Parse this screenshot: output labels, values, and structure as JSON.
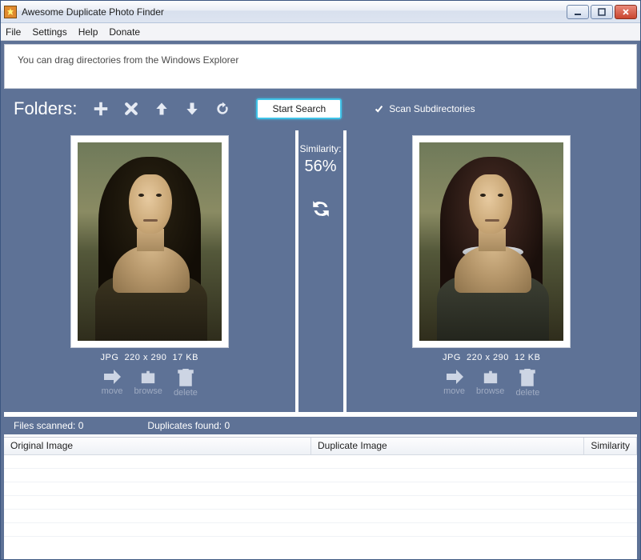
{
  "window": {
    "title": "Awesome Duplicate Photo Finder"
  },
  "menu": {
    "file": "File",
    "settings": "Settings",
    "help": "Help",
    "donate": "Donate"
  },
  "drop_hint": "You can drag directories from the Windows Explorer",
  "toolbar": {
    "folders_label": "Folders:",
    "start_search": "Start Search",
    "scan_sub": "Scan Subdirectories",
    "scan_sub_checked": true
  },
  "similarity": {
    "label": "Similarity:",
    "value": "56%"
  },
  "left": {
    "format": "JPG",
    "dimensions": "220 x 290",
    "size": "17 KB",
    "move": "move",
    "browse": "browse",
    "delete": "delete"
  },
  "right": {
    "format": "JPG",
    "dimensions": "220 x 290",
    "size": "12 KB",
    "move": "move",
    "browse": "browse",
    "delete": "delete"
  },
  "status": {
    "files_scanned_label": "Files scanned:",
    "files_scanned_value": "0",
    "dupes_label": "Duplicates found:",
    "dupes_value": "0"
  },
  "table": {
    "col_original": "Original Image",
    "col_duplicate": "Duplicate Image",
    "col_similarity": "Similarity"
  }
}
